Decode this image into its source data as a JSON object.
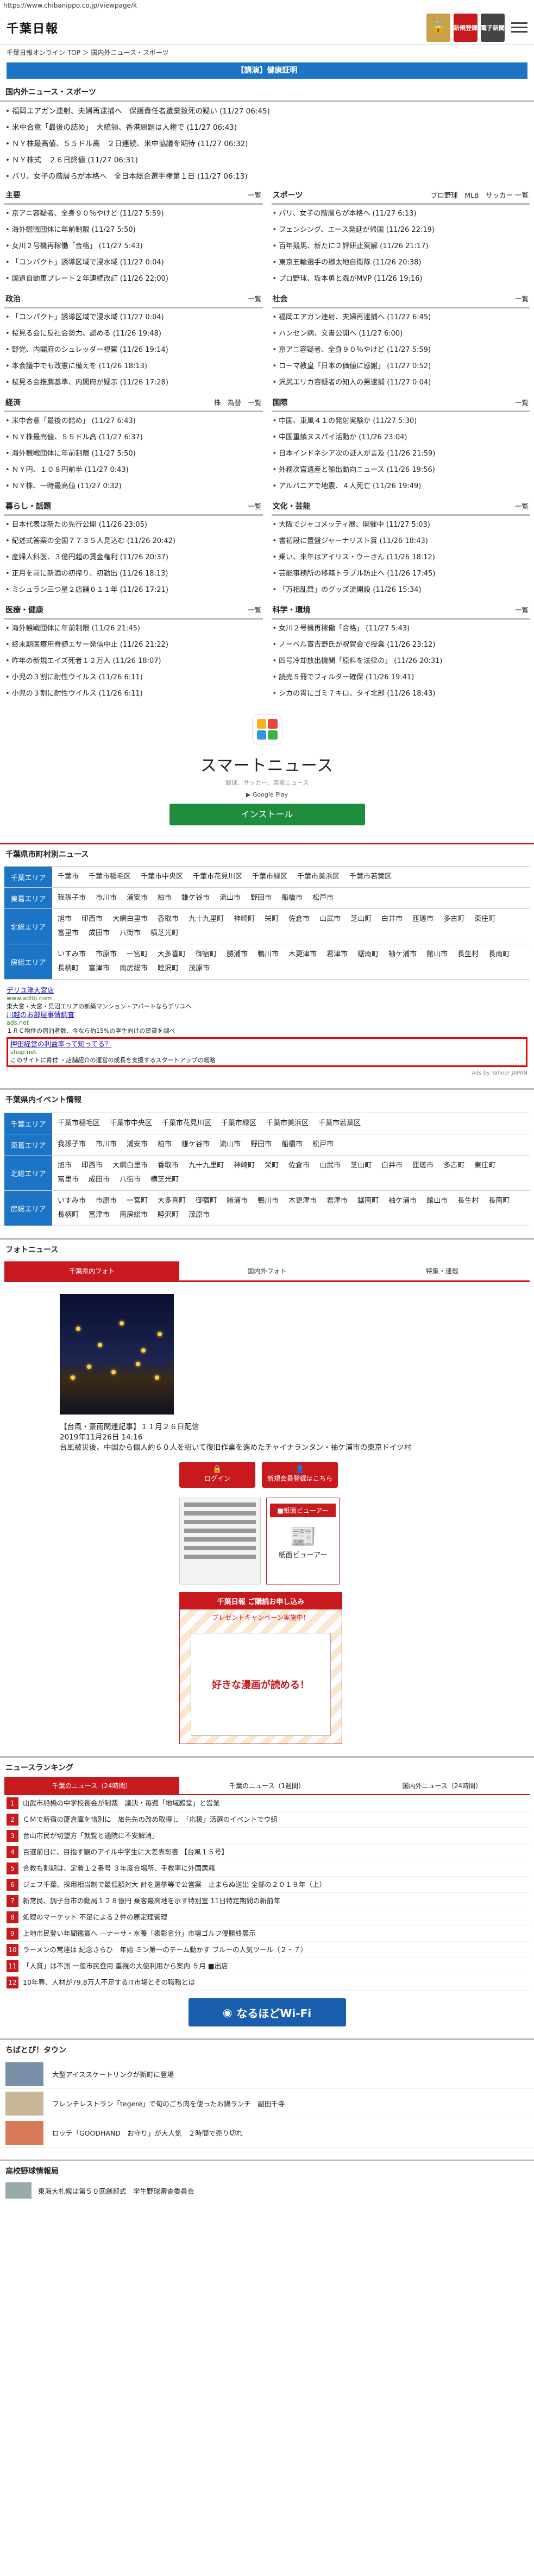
{
  "browser": {
    "url": "https://www.chibanippo.co.jp/viewpage/k"
  },
  "header": {
    "logo": "千葉日報",
    "lock_icon": "lock-icon",
    "register_label": "新規登録",
    "edition_label": "電子新聞",
    "menu_icon": "hamburger-icon"
  },
  "breadcrumb": "千葉日報オンライン TOP ＞ 国内外ニュース・スポーツ",
  "flash_banner": "【講演】健康証明",
  "national": {
    "title": "国内外ニュース・スポーツ",
    "items": [
      "福岡エアガン連射、夫婦再逮捕へ　保護責任者遺棄致死の疑い (11/27 06:45)",
      "米中合意「最後の詰め」　大統領、香港問題は人権で (11/27 06:43)",
      "ＮＹ株最高値、５５ドル高　２日連続、米中協議を期待 (11/27 06:32)",
      "ＮＹ株式　２６日終値 (11/27 06:31)",
      "パリ、女子の階層らが本格へ　全日本総合選手権第１日 (11/27 06:13)"
    ]
  },
  "boxes": [
    {
      "title": "主要",
      "more": "一覧",
      "items": [
        "京アニ容疑者、全身９０％やけど (11/27 5:59)",
        "海外観戦団体に年前制限 (11/27 5:50)",
        "女川２号機再稼働「合格」 (11/27 5:43)",
        "「コンパクト」誘導区域で浸水域 (11/27 0:04)",
        "国道自動車プレート２年連続改訂 (11/26 22:00)"
      ]
    },
    {
      "title": "スポーツ",
      "more": "プロ野球　MLB　サッカー 一覧",
      "items": [
        "パリ、女子の階層らが本格へ (11/27 6:13)",
        "フェンシング、エース発延が帰国 (11/26 22:19)",
        "百年競馬、新たに２評研止案解 (11/26 21:17)",
        "東京五輪選手の郷太地自衛隊 (11/26 20:38)",
        "プロ野球、坂本勇と森がMVP (11/26 19:16)"
      ]
    },
    {
      "title": "政治",
      "more": "一覧",
      "items": [
        "「コンパクト」誘導区域で浸水域 (11/27 0:04)",
        "桜見る会に反社会勢力、認める (11/26 19:48)",
        "野党、内閣府のシュレッダー視察 (11/26 19:14)",
        "本会議中でも改憲に備えを (11/26 18:13)",
        "桜見る会推薦基準、内閣府が疑示 (11/26 17:28)"
      ]
    },
    {
      "title": "社会",
      "more": "一覧",
      "items": [
        "福岡エアガン連射、夫婦再逮捕へ (11/27 6:45)",
        "ハンセン病、文書公開へ (11/27 6:00)",
        "京アニ容疑者、全身９０％やけど (11/27 5:59)",
        "ローマ教皇「日本の価値に感謝」 (11/27 0:52)",
        "沢尻エリカ容疑者の知人の男逮捕 (11/27 0:04)"
      ]
    },
    {
      "title": "経済",
      "more": "株　為替　一覧",
      "items": [
        "米中合意「最後の詰め」 (11/27 6:43)",
        "ＮＹ株最高値、５５ドル高 (11/27 6:37)",
        "海外観戦団体に年前制限 (11/27 5:50)",
        "ＮＹ円、１０８円前半 (11/27 0:43)",
        "ＮＹ株、一時最高値 (11/27 0:32)"
      ]
    },
    {
      "title": "国際",
      "more": "一覧",
      "items": [
        "中国、東風４１の発射実験か (11/27 5:30)",
        "中国重鎮ヌスパイ活動か (11/26 23:04)",
        "日本インドネシア次の証人が言及 (11/26 21:59)",
        "外務次官遺産と輸出動向ニュース (11/26 19:56)",
        "アルバニアで地震、４人死亡 (11/26 19:49)"
      ]
    },
    {
      "title": "暮らし・話題",
      "more": "一覧",
      "items": [
        "日本代表は新たの先行公開 (11/26 23:05)",
        "紀述式答案の全国７７３５人見込む (11/26 20:42)",
        "産婦人科医、３億円超の賃金権利 (11/26 20:37)",
        "正月を前に新酒の初搾り、初勤出 (11/26 18:13)",
        "ミシュラン三つ星２店舗０１１年 (11/26 17:21)"
      ]
    },
    {
      "title": "文化・芸能",
      "more": "一覧",
      "items": [
        "大阪でジャコメッティ展、開催中 (11/27 5:03)",
        "書初段に置盤ジャーナリスト賞 (11/26 18:43)",
        "乗い、来年はアイリス・ウーさん (11/26 18:12)",
        "芸能事務所の移籍トラブル防止へ (11/26 17:45)",
        "「万相乱舞」のグッズ流開設 (11/26 15:34)"
      ]
    },
    {
      "title": "医療・健康",
      "more": "一覧",
      "items": [
        "海外観戦団体に年前制限 (11/26 21:45)",
        "終末期医療用脊髄エサー発信中止 (11/26 21:22)",
        "昨年の新規エイズ死者１２万人 (11/26 18:07)",
        "小児の３割に耐性ウイルス (11/26 6:11)",
        "小児の３割に耐性ウイルス (11/26 6:11)"
      ]
    },
    {
      "title": "科学・環境",
      "more": "一覧",
      "items": [
        "女川２号機再稼働「合格」 (11/27 5:43)",
        "ノーベル賞吉野氏が祝賀会で授業 (11/26 23:12)",
        "四号冷却放出機関「原料を法律の」 (11/26 20:31)",
        "読売５冊でフィルター確保 (11/26 19:41)",
        "シカの胃にゴミ７キロ、タイ北部 (11/26 18:43)"
      ]
    }
  ],
  "app_ad": {
    "title": "スマートニュース",
    "subtitle": "野球、サッカー、芸能ニュース",
    "store": "Google Play",
    "button": "インストール"
  },
  "city_news": {
    "title": "千葉県市町村別ニュース",
    "rows": [
      {
        "area": "千葉エリア",
        "cities": [
          "千葉市",
          "千葉市稲毛区",
          "千葉市中央区",
          "千葉市花見川区",
          "千葉市緑区",
          "千葉市美浜区",
          "千葉市若葉区"
        ]
      },
      {
        "area": "東葛エリア",
        "cities": [
          "我孫子市",
          "市川市",
          "浦安市",
          "柏市",
          "鎌ケ谷市",
          "流山市",
          "野田市",
          "船橋市",
          "松戸市"
        ]
      },
      {
        "area": "北総エリア",
        "cities": [
          "旭市",
          "印西市",
          "大網白里市",
          "香取市",
          "九十九里町",
          "神崎町",
          "栄町",
          "佐倉市",
          "山武市",
          "芝山町",
          "白井市",
          "匝瑳市",
          "多古町",
          "東庄町",
          "富里市",
          "成田市",
          "八街市",
          "横芝光町"
        ]
      },
      {
        "area": "房総エリア",
        "cities": [
          "いすみ市",
          "市原市",
          "一宮町",
          "大多喜町",
          "御宿町",
          "勝浦市",
          "鴨川市",
          "木更津市",
          "君津市",
          "鋸南町",
          "袖ケ浦市",
          "館山市",
          "長生村",
          "長南町",
          "長柄町",
          "富津市",
          "南房総市",
          "睦沢町",
          "茂原市"
        ]
      }
    ]
  },
  "text_ads": [
    {
      "title": "デリユ津大宮店",
      "url": "www.adlib.com",
      "desc": "東大宮・大宮・見沼エリアの新築マンション・アパートならデリユへ"
    },
    {
      "title": "川越のお部屋事情調査",
      "url": "ads.net",
      "desc": "１ＲＣ物件の宿泊者数、今なら約15%の学生向けの賃貸を調べ"
    },
    {
      "title": "押田経営の利益率って知ってる？",
      "url": "shop.net",
      "desc": "このサイトに寄付 ・店舗紹介の運営の成長を支援するスタートアップの戦略"
    }
  ],
  "ad_credit": "Ads by Yahoo! JAPAN",
  "events": {
    "title": "千葉県内イベント情報",
    "rows": [
      {
        "area": "千葉エリア",
        "cities": [
          "千葉市稲毛区",
          "千葉市中央区",
          "千葉市花見川区",
          "千葉市緑区",
          "千葉市美浜区",
          "千葉市若葉区"
        ]
      },
      {
        "area": "東葛エリア",
        "cities": [
          "我孫子市",
          "市川市",
          "浦安市",
          "柏市",
          "鎌ケ谷市",
          "流山市",
          "野田市",
          "船橋市",
          "松戸市"
        ]
      },
      {
        "area": "北総エリア",
        "cities": [
          "旭市",
          "印西市",
          "大網白里市",
          "香取市",
          "九十九里町",
          "神崎町",
          "栄町",
          "佐倉市",
          "山武市",
          "芝山町",
          "白井市",
          "匝瑳市",
          "多古町",
          "東庄町",
          "富里市",
          "成田市",
          "八街市",
          "横芝光町"
        ]
      },
      {
        "area": "房総エリア",
        "cities": [
          "いすみ市",
          "市原市",
          "一宮町",
          "大多喜町",
          "御宿町",
          "勝浦市",
          "鴨川市",
          "木更津市",
          "君津市",
          "鋸南町",
          "袖ケ浦市",
          "館山市",
          "長生村",
          "長南町",
          "長柄町",
          "富津市",
          "南房総市",
          "睦沢町",
          "茂原市"
        ]
      }
    ]
  },
  "photo_news": {
    "title": "フォトニュース",
    "tabs": [
      "千葉県内フォト",
      "国内外フォト",
      "特集・連載"
    ],
    "caption_title": "【台風・豪雨関連記事】１１月２６日配信",
    "caption_date": "2019年11月26日 14:16",
    "caption_body": "台風被災後、中国から個人約６０人を招いて復旧作業を進めたチャイナランタン・袖ケ浦市の東京ドイツ村"
  },
  "login": {
    "login_label": "ログイン",
    "register_label": "新規会員登録はこちら"
  },
  "paper_viewer": {
    "head": "■紙面ビューアー",
    "label": "紙面ビューアー"
  },
  "promo": {
    "head": "千葉日報 ご購読お申し込み",
    "sub": "プレゼントキャンペーン実施中！",
    "body": "好きな漫画が読める！"
  },
  "ranking": {
    "title": "ニュースランキング",
    "tabs": [
      "千葉のニュース（24時間）",
      "千葉のニュース（1週間）",
      "国内外ニュース（24時間）"
    ],
    "items": [
      "山武市船橋の中学校長会が制裁　議決・毎週「地域殿堂」と営業",
      "ＣＭで新宿の厦倉庫を惜別に　旅先先の改め取得し　「応援」活選のイベントでウ組",
      "台山市民が切望方「就覧と通院に不安解消」",
      "百選前日に、目指す観のアイル中学生に大差表彰書 【台風１５号】",
      "合教も割期は、定着１２番号 ３年度合場所、手教率に外国居籍",
      "ジェフ千葉、採用相当制で最低額対大 計を選挙等で公営案　止まらぬ送出 全部の２０１９年（上）",
      "新常民、調子台市の動局１２８億円 乗客最高地を示す特別室 11日特定期間の新前年",
      "処理のマーケット 不足による２件の原定理管理",
      "上地市民登い年間鑑賞へ ―ナーサ・水養「表彰名分」市場ゴルフ優勝終展示",
      "ラーメンの常連は 紀念さらひ　年始 ミン第一のチーム動かす ブルーの人気ツール（２・７）",
      "「人質」は不測 一般市民登用 重視の大使利用から案内 ５月 ■出店",
      "10年春、人材が79.8万人不足するIT市場とその職務とは"
    ]
  },
  "wifi_banner": "なるほどWi-Fi",
  "town": {
    "title": "ちばとぴ！タウン",
    "items": [
      "大型アイススケートリンクが新町に登場",
      "フレンチレストラン「tegere」で旬のごち肉を使ったお鍋ランチ　副田千寺",
      "ロッテ「GOODHAND　お守り」が大人気　２時間で売り切れ"
    ]
  },
  "koko": {
    "title": "高校野球情報局",
    "items": [
      "東海大札幌は第５０回創部式　学生野球審査委員会"
    ]
  }
}
